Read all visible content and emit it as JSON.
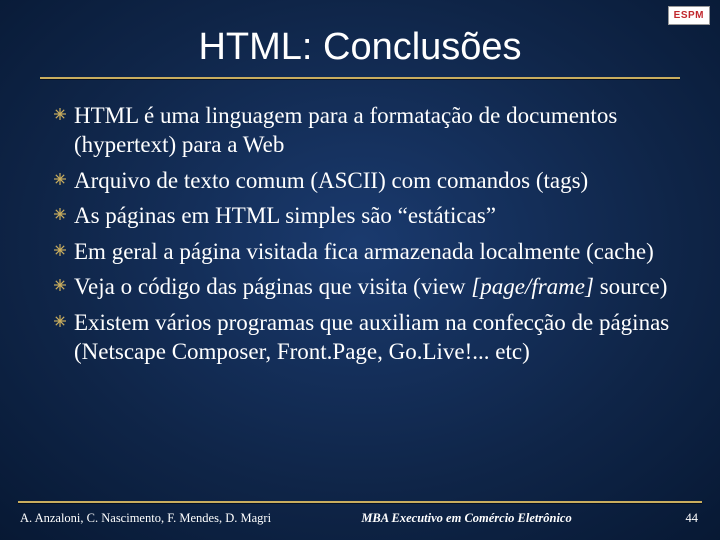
{
  "logo": "ESPM",
  "title": "HTML: Conclusões",
  "bullets": [
    {
      "text": "HTML é uma linguagem para a formatação de documentos (hypertext) para a Web"
    },
    {
      "text": "Arquivo de texto comum (ASCII) com comandos (tags)"
    },
    {
      "text": "As páginas em HTML simples são “estáticas”"
    },
    {
      "text": "Em geral a página visitada fica armazenada localmente (cache)"
    },
    {
      "pre": "Veja o código das páginas que visita (view ",
      "italic": "[page/frame]",
      "post": " source)"
    },
    {
      "text": "Existem vários programas que auxiliam na confecção de páginas (Netscape Composer, Front.Page, Go.Live!... etc)"
    }
  ],
  "footer": {
    "authors": "A. Anzaloni, C. Nascimento, F. Mendes, D. Magri",
    "course": "MBA Executivo em Comércio Eletrônico",
    "page": "44"
  }
}
